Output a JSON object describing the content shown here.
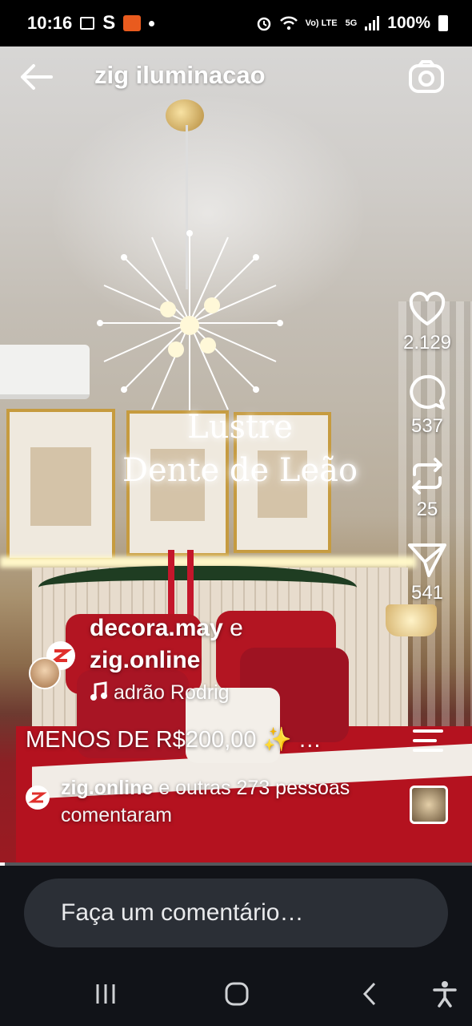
{
  "status_bar": {
    "time": "10:16",
    "s_label": "S",
    "network_label": "Vo) LTE",
    "network_5g": "5G",
    "battery": "100%"
  },
  "header": {
    "title": "zig iluminacao",
    "back_icon": "arrow-left-icon",
    "camera_icon": "camera-icon"
  },
  "video_overlay": {
    "line1": "Lustre",
    "line2": "Dente de Leão"
  },
  "actions": {
    "likes": "2.129",
    "comments": "537",
    "reposts": "25",
    "shares": "541"
  },
  "author": {
    "name1": "decora.may",
    "connector": "e",
    "name2": "zig.online",
    "music": "adrão   Rodrig"
  },
  "caption": "MENOS DE R$200,00 ✨ …",
  "activity": {
    "name": "zig.online",
    "rest": "e outras 273 pessoas",
    "line2": "comentaram"
  },
  "comment_placeholder": "Faça um comentário…",
  "nav": {
    "recent_icon": "recent-apps-icon",
    "home_icon": "home-icon",
    "back_icon": "back-icon",
    "accessibility_icon": "accessibility-icon"
  },
  "colors": {
    "accent_red": "#c4162b",
    "bar_bg": "#111318",
    "input_bg": "#2b2f36"
  }
}
